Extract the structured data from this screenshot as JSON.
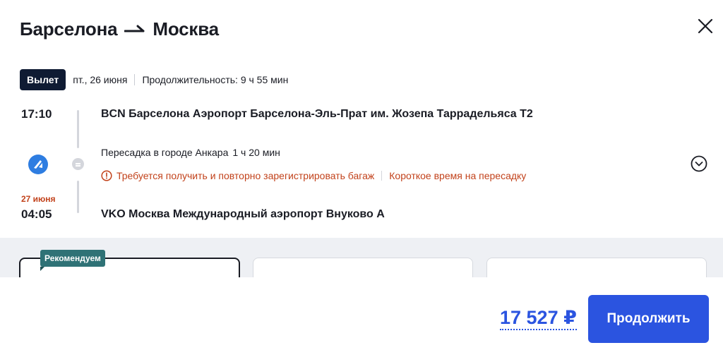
{
  "route": {
    "from": "Барселона",
    "to": "Москва"
  },
  "departure": {
    "badge": "Вылет",
    "date": "пт., 26 июня",
    "duration": "Продолжительность: 9 ч 55 мин"
  },
  "segment": {
    "dep_time": "17:10",
    "dep_airport": "BCN Барселона Аэропорт Барселона-Эль-Прат им. Жозепа Таррадельяса T2",
    "arr_date": "27 июня",
    "arr_time": "04:05",
    "arr_airport": "VKO Москва Международный аэропорт Внуково A"
  },
  "transfer": {
    "text": "Пересадка в городе Анкара",
    "duration": "1 ч 20 мин",
    "warning_baggage": "Требуется получить и повторно зарегистрировать багаж",
    "warning_short": "Короткое время на пересадку"
  },
  "tariffs": {
    "recommended_label": "Рекомендуем"
  },
  "footer": {
    "price": "17 527 ₽",
    "continue_label": "Продолжить"
  },
  "colors": {
    "accent": "#2b54e0",
    "warning": "#c2421b",
    "badge_bg": "#0f1b33",
    "recommended_bg": "#2f7276"
  },
  "icons": {
    "close": "close-icon",
    "arrow": "flight-arrow-icon",
    "airline": "airline-logo-icon",
    "warning": "warning-icon",
    "expand": "chevron-down-circle-icon"
  }
}
